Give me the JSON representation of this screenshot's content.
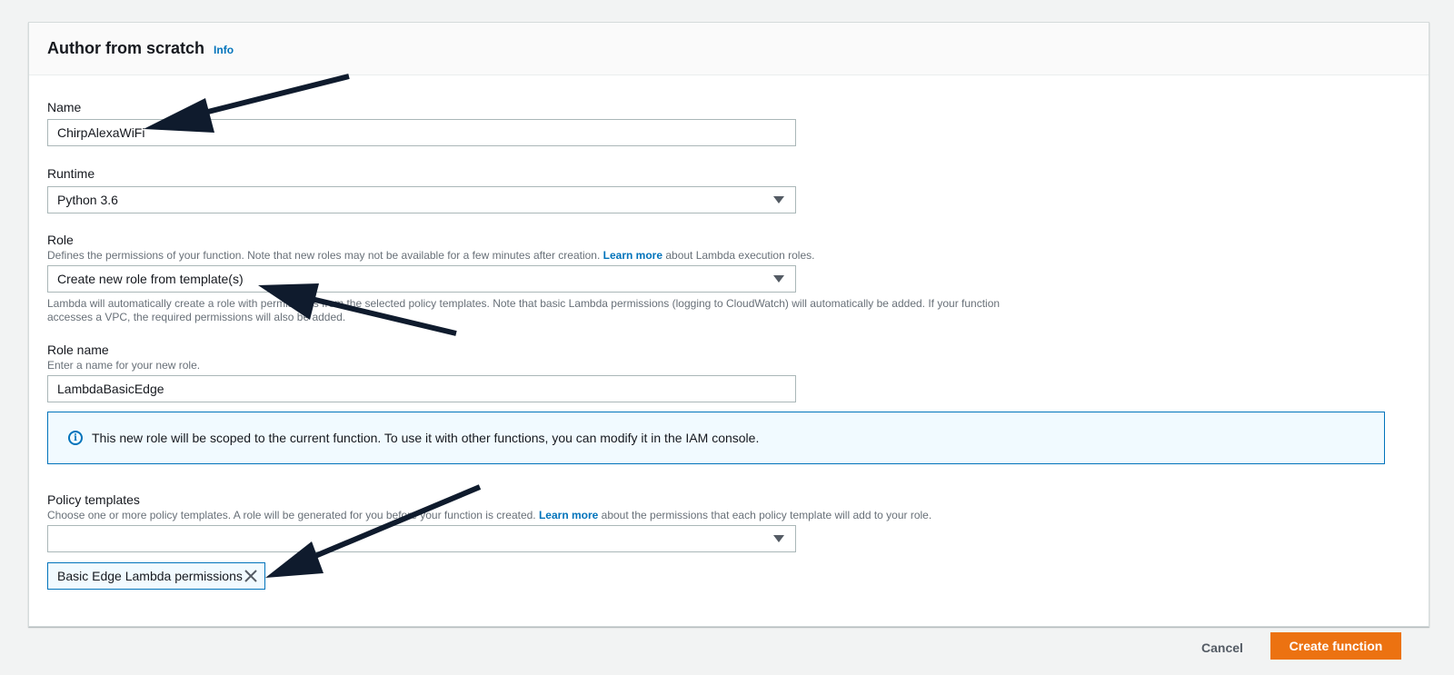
{
  "panel": {
    "title": "Author from scratch",
    "info_link": "Info"
  },
  "name_field": {
    "label": "Name",
    "value": "ChirpAlexaWiFi"
  },
  "runtime_field": {
    "label": "Runtime",
    "value": "Python 3.6"
  },
  "role_field": {
    "label": "Role",
    "desc_before": "Defines the permissions of your function. Note that new roles may not be available for a few minutes after creation. ",
    "desc_link": "Learn more",
    "desc_after": " about Lambda execution roles.",
    "value": "Create new role from template(s)",
    "help_line1": "Lambda will automatically create a role with permissions from the selected policy templates. Note that basic Lambda permissions (logging to CloudWatch) will automatically be added. If your function",
    "help_line2": "accesses a VPC, the required permissions will also be added."
  },
  "role_name_field": {
    "label": "Role name",
    "desc": "Enter a name for your new role.",
    "value": "LambdaBasicEdge"
  },
  "info_box": {
    "text": "This new role will be scoped to the current function. To use it with other functions, you can modify it in the IAM console."
  },
  "policy_field": {
    "label": "Policy templates",
    "desc_before": "Choose one or more policy templates. A role will be generated for you before your function is created. ",
    "desc_link": "Learn more",
    "desc_after": " about the permissions that each policy template will add to your role.",
    "value": "",
    "selected_tokens": [
      "Basic Edge Lambda permissions"
    ]
  },
  "footer": {
    "cancel_label": "Cancel",
    "create_label": "Create function"
  },
  "colors": {
    "primary_button": "#ec7211",
    "link": "#0073bb",
    "arrow": "#0f1b2d"
  },
  "icons": {
    "info": "info-circle-icon",
    "caret": "caret-down-icon",
    "close": "close-icon"
  }
}
